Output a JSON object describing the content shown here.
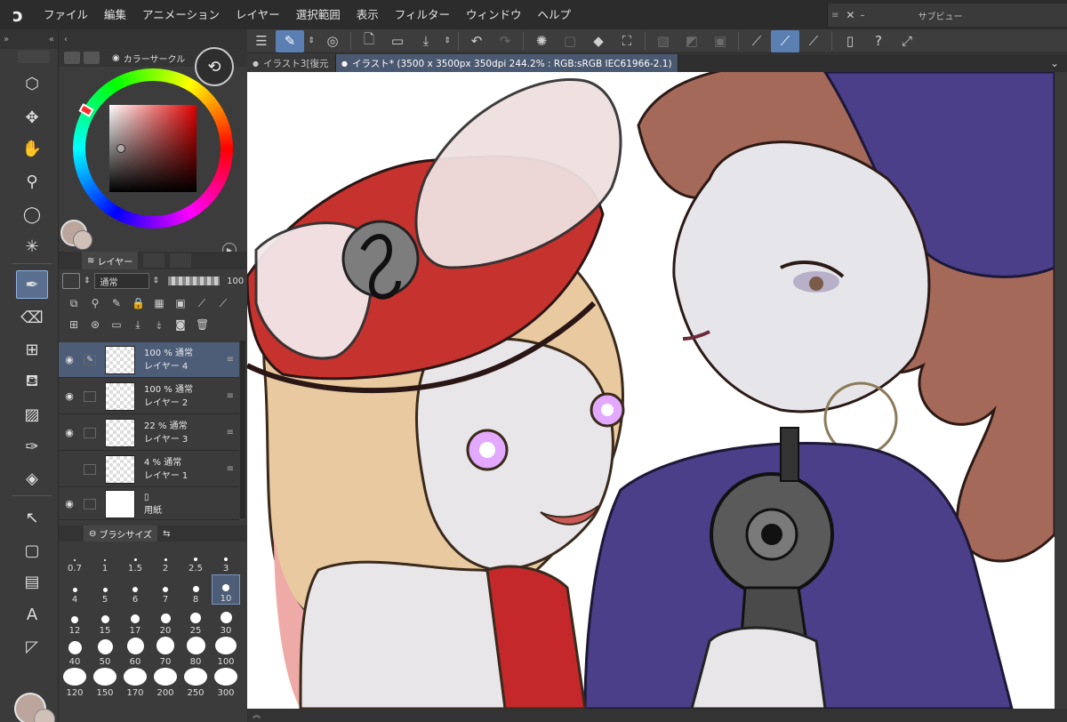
{
  "menu": [
    "ファイル",
    "編集",
    "アニメーション",
    "レイヤー",
    "選択範囲",
    "表示",
    "フィルター",
    "ウィンドウ",
    "ヘルプ"
  ],
  "subview": {
    "title": "サブビュー"
  },
  "tabs": [
    {
      "label": "イラスト3[復元"
    },
    {
      "label": "イラスト* (3500 x 3500px 350dpi 244.2% : RGB:sRGB IEC61966-2.1)"
    }
  ],
  "color_panel": {
    "title": "カラーサークル",
    "r": "186",
    "g": "164",
    "b": "164",
    "main_color": "#bca59c",
    "sub_color": "#cfc0b8"
  },
  "layer_panel": {
    "title": "レイヤー",
    "blend_mode": "通常",
    "opacity": "100",
    "layers": [
      {
        "opacity_mode": "100 % 通常",
        "name": "レイヤー 4",
        "selected": true
      },
      {
        "opacity_mode": "100 % 通常",
        "name": "レイヤー 2",
        "selected": false
      },
      {
        "opacity_mode": "22 % 通常",
        "name": "レイヤー 3",
        "selected": false
      },
      {
        "opacity_mode": "4 % 通常",
        "name": "レイヤー 1",
        "selected": false
      },
      {
        "opacity_mode": "",
        "name": "用紙",
        "selected": false
      }
    ]
  },
  "brush_panel": {
    "title": "ブラシサイズ",
    "sizes": [
      "0.7",
      "1",
      "1.5",
      "2",
      "2.5",
      "3",
      "4",
      "5",
      "6",
      "7",
      "8",
      "10",
      "12",
      "15",
      "17",
      "20",
      "25",
      "30",
      "40",
      "50",
      "60",
      "70",
      "80",
      "100",
      "120",
      "150",
      "170",
      "200",
      "250",
      "300"
    ],
    "selected": "10"
  },
  "toolbar_icons": [
    "sub-tool-icon",
    "move-icon",
    "hand-icon",
    "zoom-icon",
    "lasso-icon",
    "magic-wand-icon",
    "pen-icon",
    "eraser-icon",
    "grid-icon",
    "fill-icon",
    "pattern-icon",
    "eyedropper-icon",
    "bucket-icon",
    "select-arrow-icon",
    "rectangle-icon",
    "gradient-icon",
    "text-icon",
    "ruler-icon"
  ],
  "canvas": {
    "description": "illustration"
  }
}
